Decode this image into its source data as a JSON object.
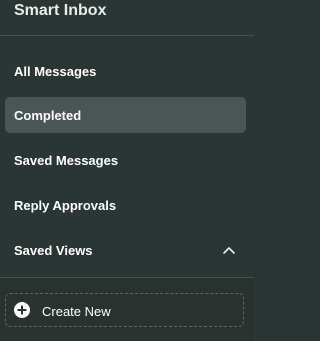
{
  "header": {
    "title": "Smart Inbox"
  },
  "nav": {
    "items": [
      {
        "label": "All Messages",
        "active": false
      },
      {
        "label": "Completed",
        "active": true
      },
      {
        "label": "Saved Messages",
        "active": false
      },
      {
        "label": "Reply Approvals",
        "active": false
      },
      {
        "label": "Saved Views",
        "active": false,
        "expanded": true
      }
    ]
  },
  "create": {
    "label": "Create New",
    "icon": "plus-circle-icon"
  },
  "colors": {
    "background": "#2b3533",
    "active_item": "#4b5553",
    "divider": "#46504e"
  }
}
